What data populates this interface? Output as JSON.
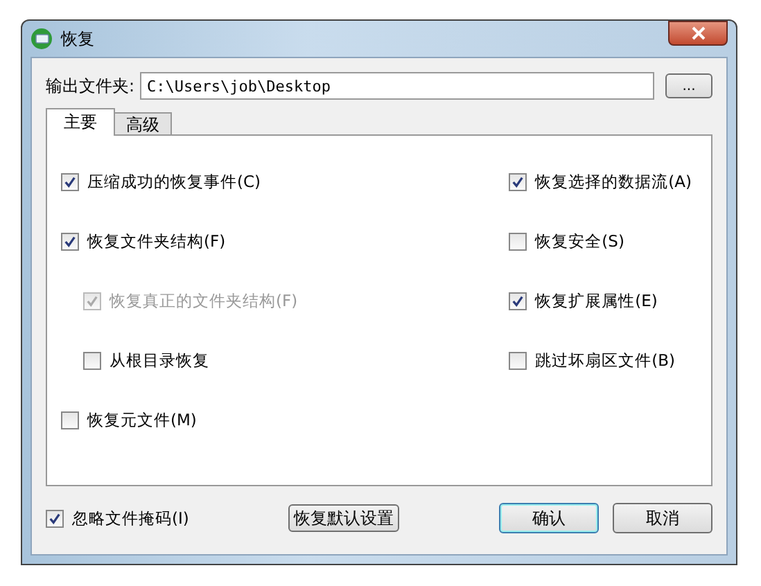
{
  "window": {
    "title": "恢复"
  },
  "output_folder": {
    "label": "输出文件夹:",
    "value": "C:\\Users\\job\\Desktop",
    "browse_button": "..."
  },
  "tabs": [
    {
      "label": "主要",
      "selected": true
    },
    {
      "label": "高级",
      "selected": false
    }
  ],
  "left_options": [
    {
      "label": "压缩成功的恢复事件(C)",
      "checked": true,
      "disabled": false
    },
    {
      "label": "恢复文件夹结构(F)",
      "checked": true,
      "disabled": false,
      "children": [
        {
          "label": "恢复真正的文件夹结构(F)",
          "checked": true,
          "disabled": true
        },
        {
          "label": "从根目录恢复",
          "checked": false,
          "disabled": false
        }
      ]
    },
    {
      "label": "恢复元文件(M)",
      "checked": false,
      "disabled": false
    }
  ],
  "right_options": [
    {
      "label": "恢复选择的数据流(A)",
      "checked": true,
      "disabled": false
    },
    {
      "label": "恢复安全(S)",
      "checked": false,
      "disabled": false
    },
    {
      "label": "恢复扩展属性(E)",
      "checked": true,
      "disabled": false
    },
    {
      "label": "跳过坏扇区文件(B)",
      "checked": false,
      "disabled": false
    }
  ],
  "ignore_mask": {
    "label": "忽略文件掩码(I)",
    "checked": true
  },
  "buttons": [
    {
      "label": "恢复默认设置",
      "kind": "plain"
    },
    {
      "label": "确认",
      "kind": "default"
    },
    {
      "label": "取消",
      "kind": "plain"
    }
  ]
}
